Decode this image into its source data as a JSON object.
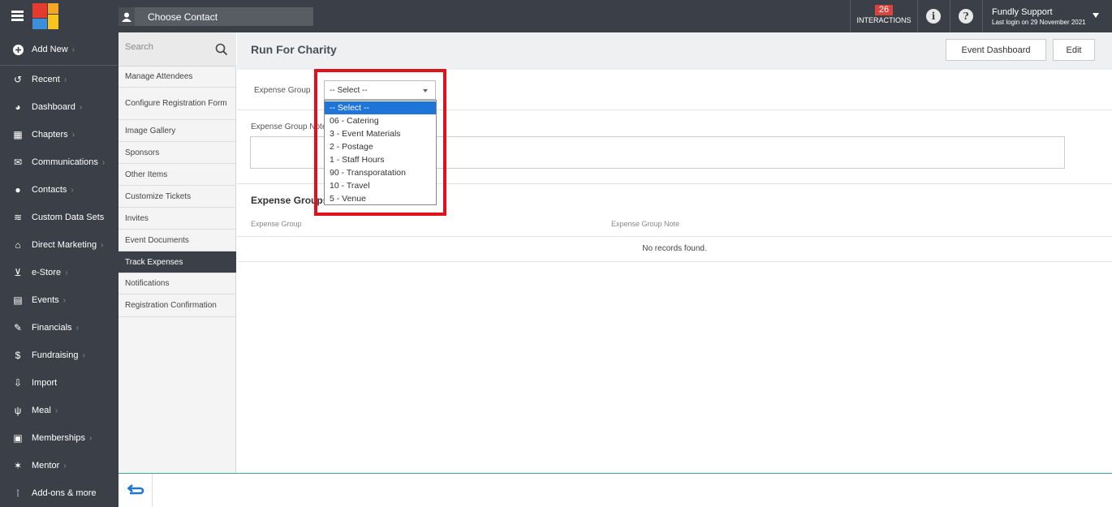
{
  "topbar": {
    "choose_contact": "Choose Contact",
    "interactions_count": "26",
    "interactions_label": "INTERACTIONS",
    "user_name": "Fundly Support",
    "last_login": "Last login on 29 November 2021",
    "brand_colors": [
      "#e53a2f",
      "#f5a623",
      "#3c8fdc",
      "#f7c51e"
    ]
  },
  "sidebar": {
    "add_new": "Add New",
    "items": [
      {
        "label": "Recent",
        "icon": "history-icon",
        "glyph": "↺",
        "chevron": true
      },
      {
        "label": "Dashboard",
        "icon": "dashboard-icon",
        "glyph": "◕",
        "chevron": true
      },
      {
        "label": "Chapters",
        "icon": "grid-icon",
        "glyph": "▦",
        "chevron": true
      },
      {
        "label": "Communications",
        "icon": "envelope-icon",
        "glyph": "✉",
        "chevron": true
      },
      {
        "label": "Contacts",
        "icon": "user-icon",
        "glyph": "●",
        "chevron": true
      },
      {
        "label": "Custom Data Sets",
        "icon": "database-icon",
        "glyph": "≋",
        "chevron": false
      },
      {
        "label": "Direct Marketing",
        "icon": "bank-icon",
        "glyph": "⌂",
        "chevron": true
      },
      {
        "label": "e-Store",
        "icon": "cart-icon",
        "glyph": "⊻",
        "chevron": true
      },
      {
        "label": "Events",
        "icon": "calendar-icon",
        "glyph": "▤",
        "chevron": true
      },
      {
        "label": "Financials",
        "icon": "money-icon",
        "glyph": "✎",
        "chevron": true
      },
      {
        "label": "Fundraising",
        "icon": "moneybag-icon",
        "glyph": "$",
        "chevron": true
      },
      {
        "label": "Import",
        "icon": "import-icon",
        "glyph": "⇩",
        "chevron": false
      },
      {
        "label": "Meal",
        "icon": "utensils-icon",
        "glyph": "ψ",
        "chevron": true
      },
      {
        "label": "Memberships",
        "icon": "id-card-icon",
        "glyph": "▣",
        "chevron": true
      },
      {
        "label": "Mentor",
        "icon": "mentor-icon",
        "glyph": "✶",
        "chevron": true
      },
      {
        "label": "Add-ons & more",
        "icon": "apps-icon",
        "glyph": "⁞",
        "chevron": false
      }
    ]
  },
  "submenu": {
    "search_placeholder": "Search",
    "items": [
      {
        "label": "Manage Attendees",
        "active": false
      },
      {
        "label": "Configure Registration Form",
        "active": false
      },
      {
        "label": "Image Gallery",
        "active": false
      },
      {
        "label": "Sponsors",
        "active": false
      },
      {
        "label": "Other Items",
        "active": false
      },
      {
        "label": "Customize Tickets",
        "active": false
      },
      {
        "label": "Invites",
        "active": false
      },
      {
        "label": "Event Documents",
        "active": false
      },
      {
        "label": "Track Expenses",
        "active": true
      },
      {
        "label": "Notifications",
        "active": false
      },
      {
        "label": "Registration Confirmation",
        "active": false
      }
    ]
  },
  "main": {
    "title": "Run For Charity",
    "event_dashboard_button": "Event Dashboard",
    "edit_button": "Edit",
    "expense_group_label": "Expense Group",
    "expense_group_note_label": "Expense Group Note",
    "select_value": "-- Select --",
    "options": [
      "-- Select --",
      "06 - Catering",
      "3 - Event Materials",
      "2 - Postage",
      "1 - Staff Hours",
      "90 - Transporatation",
      "10 - Travel",
      "5 - Venue"
    ],
    "section_title": "Expense Groups",
    "table_headers": [
      "Expense Group",
      "Expense Group Note"
    ],
    "empty_message": "No records found."
  }
}
